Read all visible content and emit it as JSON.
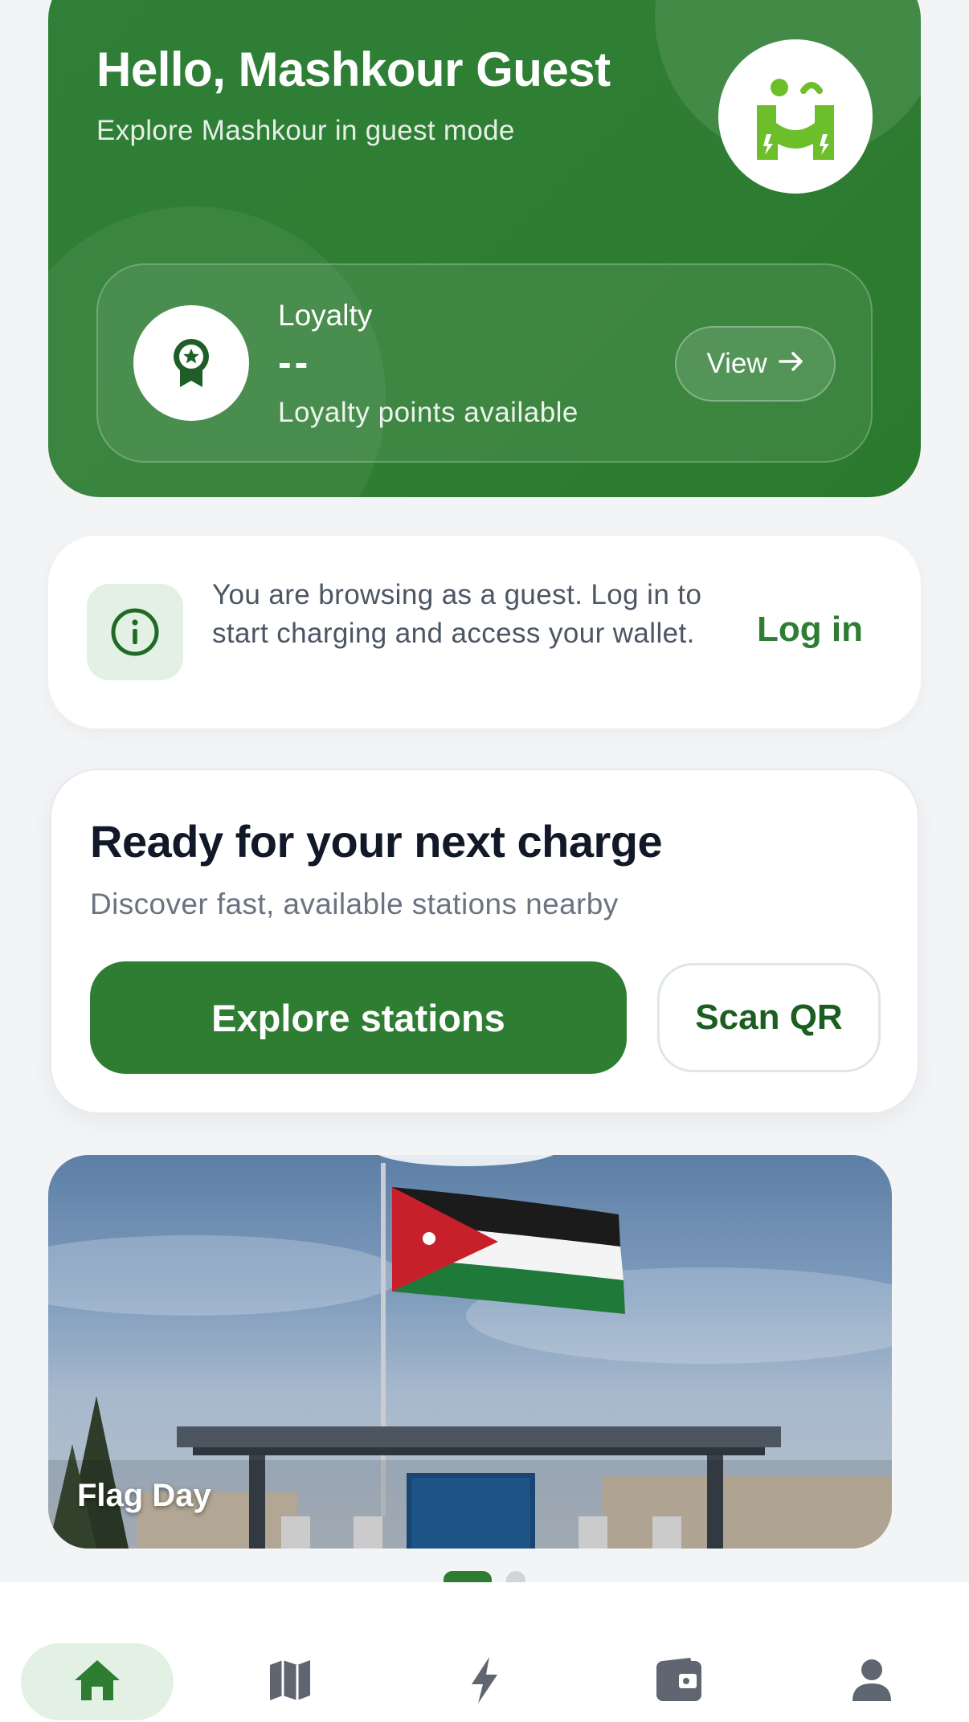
{
  "hero": {
    "greeting": "Hello, Mashkour Guest",
    "subtitle": "Explore Mashkour in guest mode",
    "logo_icon": "mashkour-logo",
    "loyalty": {
      "icon": "award-icon",
      "label": "Loyalty",
      "value": "--",
      "caption": "Loyalty points available",
      "view_label": "View",
      "view_icon": "arrow-right-icon"
    }
  },
  "notice": {
    "icon": "info-icon",
    "text": "You are browsing as a guest. Log in to start charging and access your wallet.",
    "login_label": "Log in"
  },
  "ready": {
    "title": "Ready for your next charge",
    "subtitle": "Discover fast, available stations nearby",
    "explore_label": "Explore stations",
    "scan_label": "Scan QR"
  },
  "banner": {
    "caption": "Flag Day",
    "slide_count": 2,
    "active_slide": 1
  },
  "nav": {
    "items": [
      {
        "icon": "home-icon",
        "active": true
      },
      {
        "icon": "map-icon",
        "active": false
      },
      {
        "icon": "lightning-icon",
        "active": false
      },
      {
        "icon": "wallet-icon",
        "active": false
      },
      {
        "icon": "profile-icon",
        "active": false
      }
    ]
  },
  "colors": {
    "brand_green": "#2e7d32",
    "light_green": "#e3f1e4",
    "logo_green": "#6cbf2a",
    "nav_icon_gray": "#5f6672"
  }
}
